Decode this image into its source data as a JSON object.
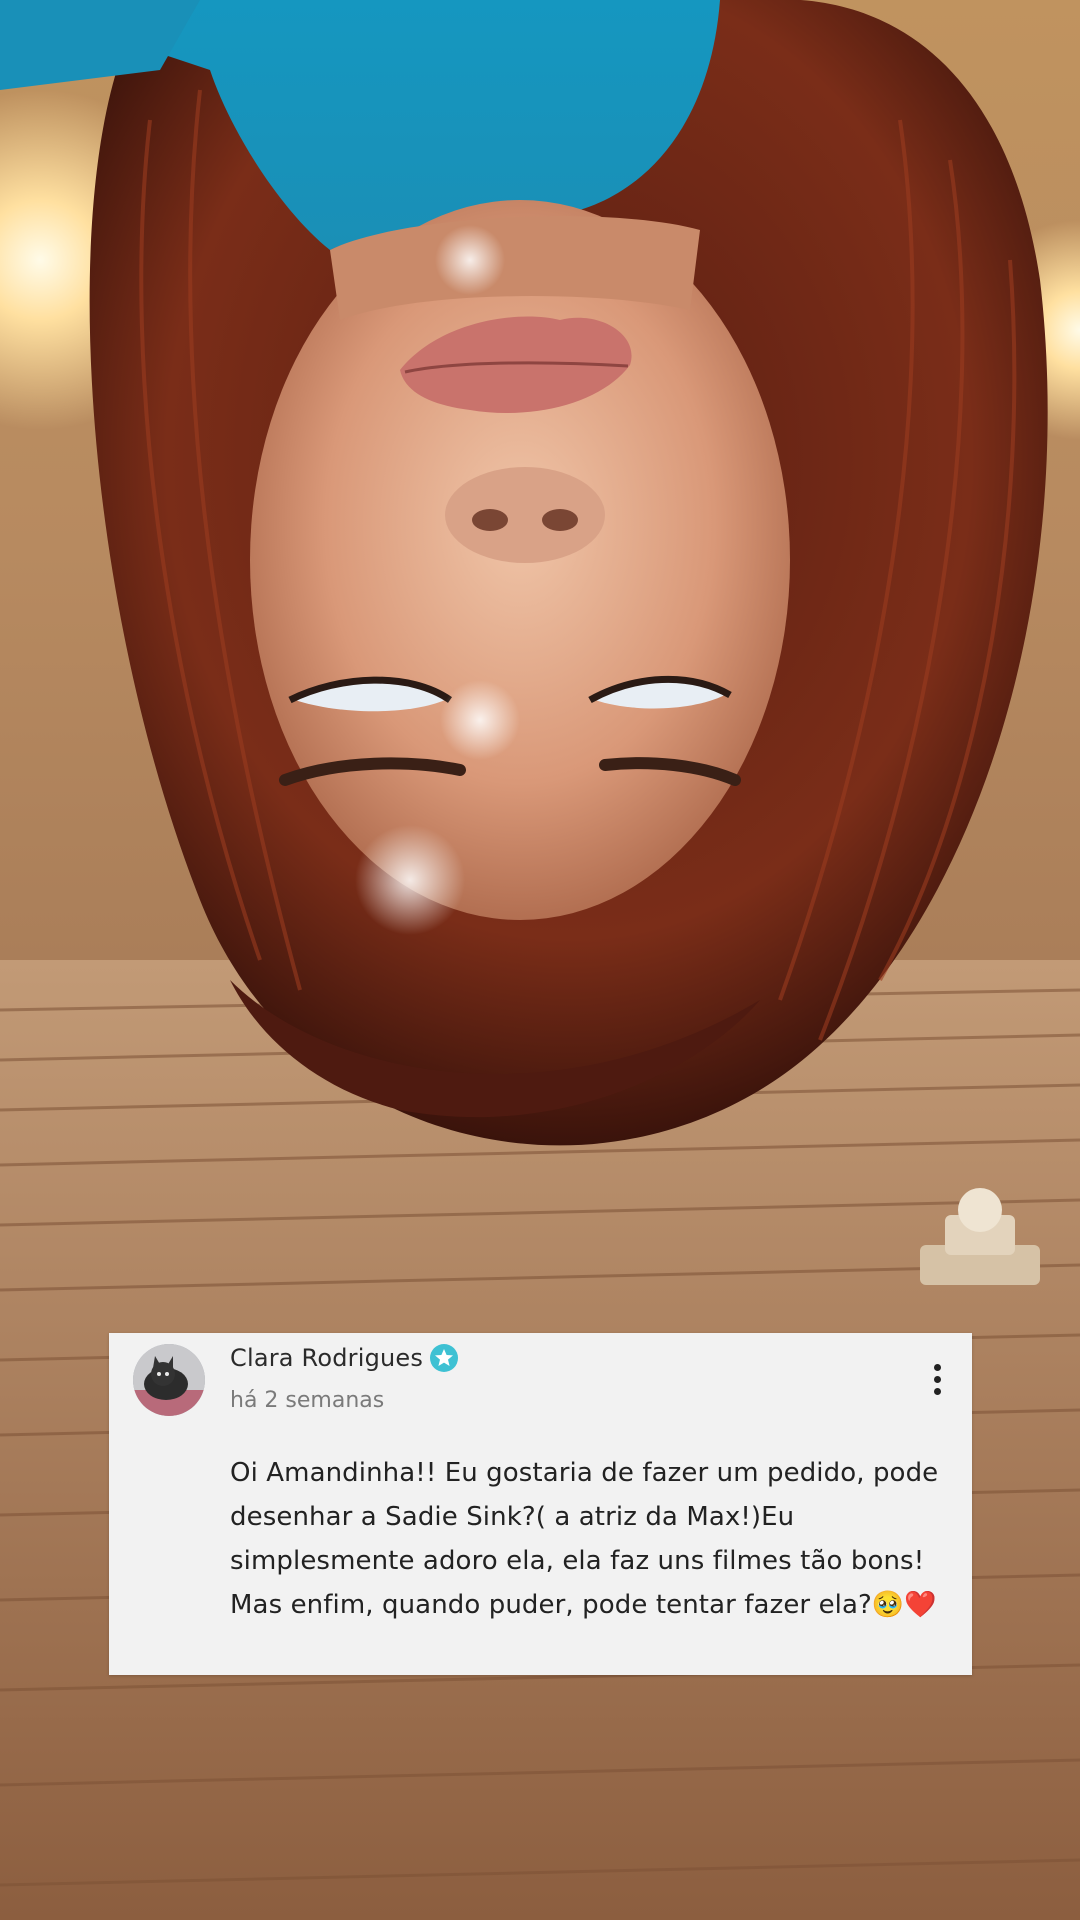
{
  "photo": {
    "description_icon": "upside-down-selfie-photo",
    "colors": {
      "shirt": "#1a9fc6",
      "hair": "#7a2a18",
      "skin": "#d99878",
      "wall": "#b3845c",
      "floor": "#a5734f",
      "lamp_glow": "#ffe3a0"
    }
  },
  "comment": {
    "author": "Clara Rodrigues",
    "verified_icon": "verified-badge-icon",
    "time": "há 2 semanas",
    "text": "Oi Amandinha!! Eu gostaria de fazer um pedido, pode desenhar a Sadie Sink?( a atriz da Max!)Eu simplesmente adoro ela, ela faz uns filmes tão bons! Mas enfim, quando puder, pode tentar fazer ela?🥹❤️",
    "more_icon": "more-vertical-icon",
    "accent_color": "#3ec1d3"
  }
}
